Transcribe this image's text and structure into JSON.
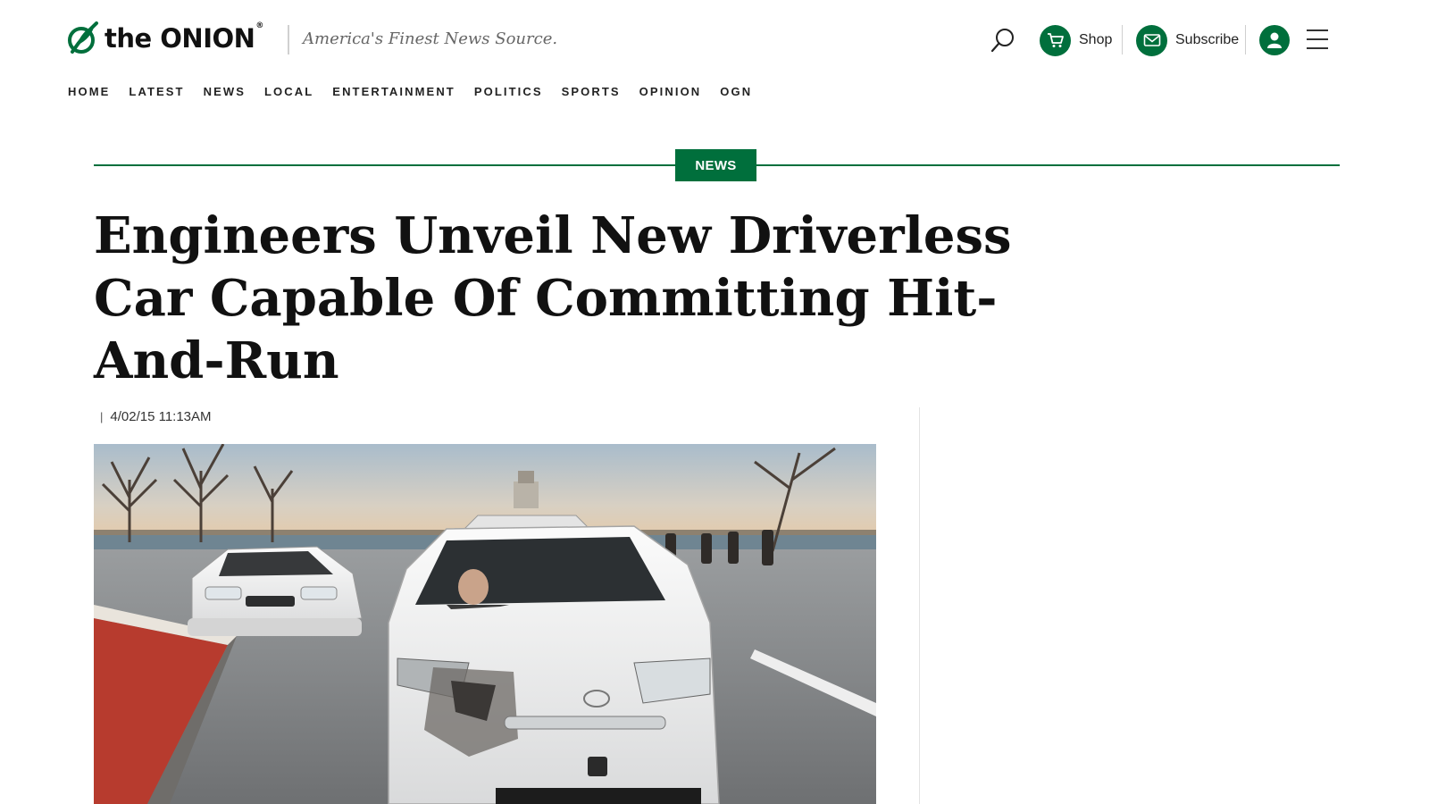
{
  "header": {
    "logo_text": "the ONION",
    "logo_reg": "®",
    "tagline": "America's Finest News Source.",
    "shop_label": "Shop",
    "subscribe_label": "Subscribe",
    "icons": {
      "search": "search-icon",
      "shop": "cart-icon",
      "subscribe": "mail-icon",
      "account": "user-icon",
      "menu": "hamburger-icon"
    }
  },
  "nav": {
    "items": [
      "HOME",
      "LATEST",
      "NEWS",
      "LOCAL",
      "ENTERTAINMENT",
      "POLITICS",
      "SPORTS",
      "OPINION",
      "OGN"
    ]
  },
  "article": {
    "section": "NEWS",
    "headline": "Engineers Unveil New Driverless Car Capable Of Committing Hit-And-Run",
    "byline_separator": "|",
    "timestamp": "4/02/15 11:13AM"
  },
  "colors": {
    "brand_green": "#006f3c",
    "text": "#111111",
    "tagline": "#666666"
  }
}
